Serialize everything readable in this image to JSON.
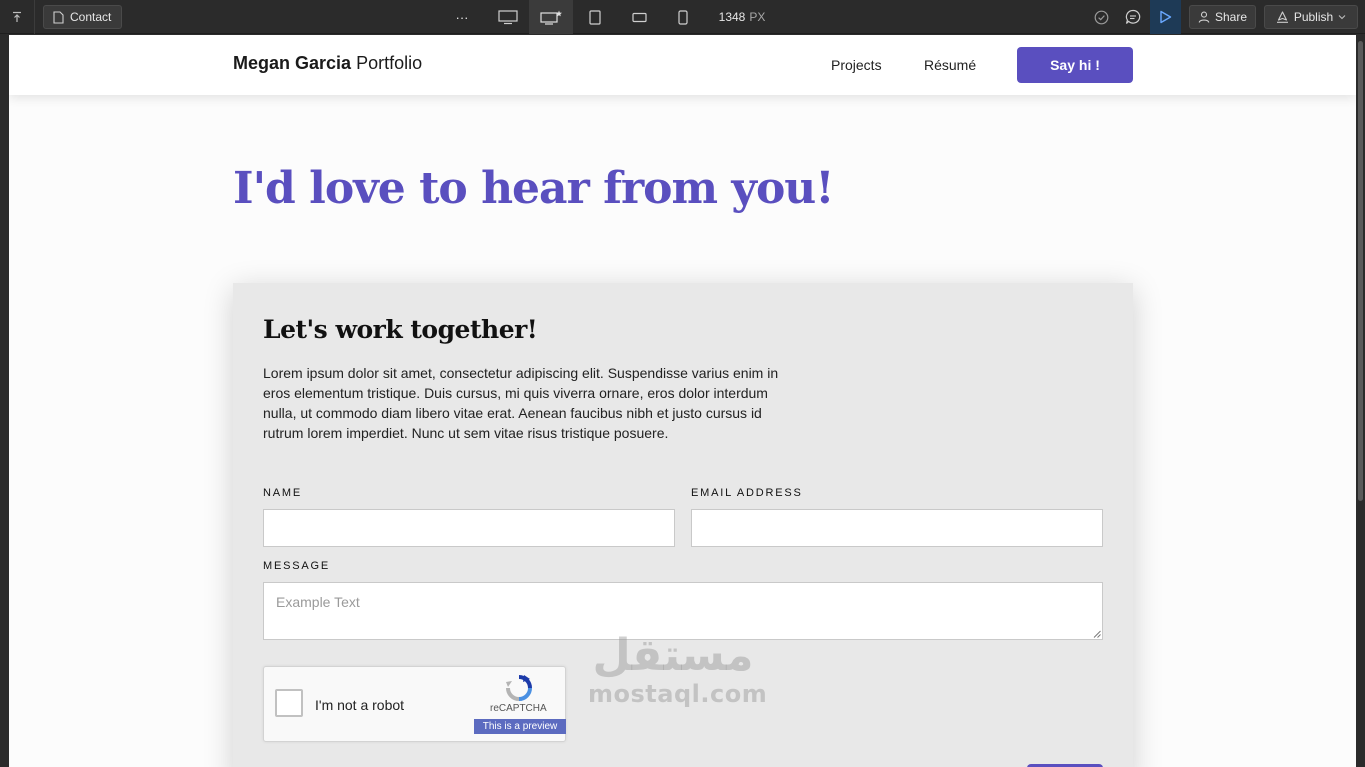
{
  "toolbar": {
    "page_name": "Contact",
    "more_label": "···",
    "canvas_width_value": "1348",
    "canvas_width_unit": "PX",
    "share_label": "Share",
    "publish_label": "Publish",
    "icons": {
      "collapse": "arrow-up-to-line-icon",
      "page": "page-icon",
      "desktop": "desktop-icon",
      "desktop_base": "desktop-star-icon",
      "tablet": "tablet-icon",
      "mobile_landscape": "mobile-landscape-icon",
      "mobile_portrait": "mobile-portrait-icon",
      "check": "check-circle-icon",
      "comment": "comment-icon",
      "preview": "play-icon",
      "user": "user-icon",
      "publish": "rocket-icon",
      "chevron": "chevron-down-icon"
    }
  },
  "site": {
    "brand_name": "Megan Garcia",
    "brand_suffix": "Portfolio",
    "nav": {
      "projects": "Projects",
      "resume": "Résumé",
      "cta": "Say hi !"
    },
    "hero_title": "I'd love to hear from you!",
    "contact": {
      "title": "Let's work together!",
      "body": "Lorem ipsum dolor sit amet, consectetur adipiscing elit. Suspendisse varius enim in eros elementum tristique. Duis cursus, mi quis viverra ornare, eros dolor interdum nulla, ut commodo diam libero vitae erat. Aenean faucibus nibh et justo cursus id rutrum lorem imperdiet. Nunc ut sem vitae risus tristique posuere.",
      "name_label": "NAME",
      "name_value": "",
      "email_label": "EMAIL ADDRESS",
      "email_value": "",
      "message_label": "MESSAGE",
      "message_placeholder": "Example Text"
    },
    "captcha": {
      "label": "I'm not a robot",
      "brand": "reCAPTCHA",
      "preview_note": "This is a preview"
    }
  },
  "watermark": {
    "arabic": "مستقل",
    "latin": "mostaql.com"
  },
  "colors": {
    "accent": "#5a4fbf",
    "toolbar_bg": "#2b2b2b",
    "card_bg": "#e8e8e8",
    "captcha_preview": "#5c6bc0"
  }
}
